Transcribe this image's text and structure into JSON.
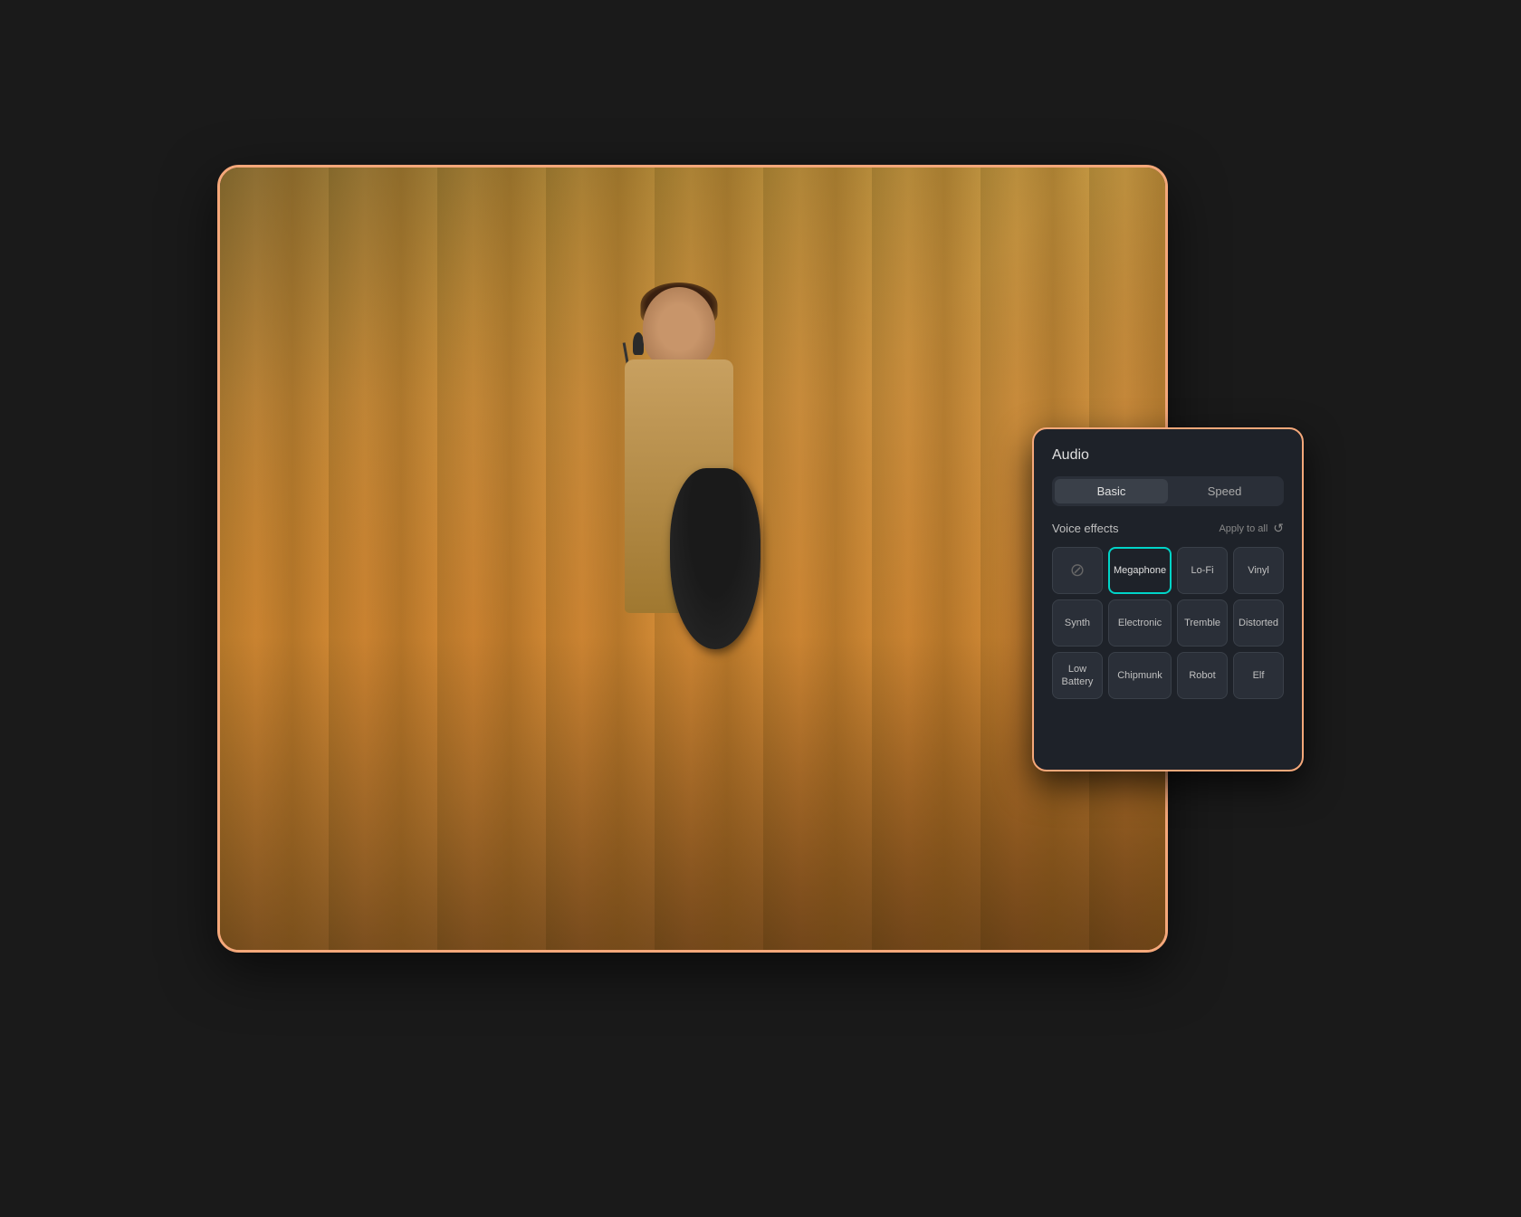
{
  "panel": {
    "title": "Audio",
    "tabs": [
      {
        "id": "basic",
        "label": "Basic",
        "active": true
      },
      {
        "id": "speed",
        "label": "Speed",
        "active": false
      }
    ],
    "voice_effects": {
      "label": "Voice effects",
      "apply_to_all": "Apply to all",
      "reset_icon": "↺",
      "effects": [
        {
          "id": "none",
          "label": "",
          "type": "none",
          "selected": false
        },
        {
          "id": "megaphone",
          "label": "Megaphone",
          "selected": true
        },
        {
          "id": "lofi",
          "label": "Lo-Fi",
          "selected": false
        },
        {
          "id": "vinyl",
          "label": "Vinyl",
          "selected": false
        },
        {
          "id": "synth",
          "label": "Synth",
          "selected": false
        },
        {
          "id": "electronic",
          "label": "Electronic",
          "selected": false
        },
        {
          "id": "tremble",
          "label": "Tremble",
          "selected": false
        },
        {
          "id": "distorted",
          "label": "Distorted",
          "selected": false
        },
        {
          "id": "lowbattery",
          "label": "Low Battery",
          "selected": false
        },
        {
          "id": "chipmunk",
          "label": "Chipmunk",
          "selected": false
        },
        {
          "id": "robot",
          "label": "Robot",
          "selected": false
        },
        {
          "id": "elf",
          "label": "Elf",
          "selected": false
        }
      ]
    }
  }
}
